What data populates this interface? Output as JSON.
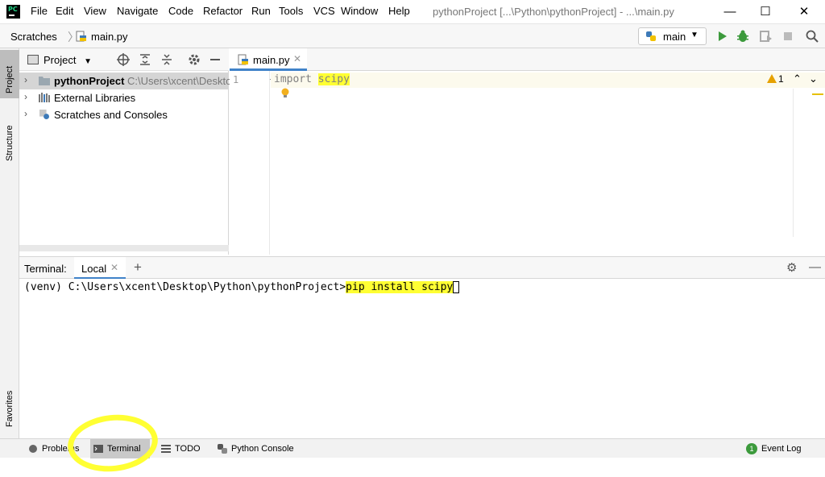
{
  "titlebar": {
    "menus": [
      "File",
      "Edit",
      "View",
      "Navigate",
      "Code",
      "Refactor",
      "Run",
      "Tools",
      "VCS",
      "Window",
      "Help"
    ],
    "title": "pythonProject [...\\Python\\pythonProject] - ...\\main.py",
    "minimize": "—",
    "maximize": "☐",
    "close": "✕"
  },
  "navbar": {
    "crumbs": [
      "Scratches",
      "main.py"
    ],
    "separator": "〉",
    "run_config": "main",
    "run_config_arrow": "▼",
    "tools": [
      "run-icon",
      "debug-icon",
      "coverage-icon",
      "stop-icon",
      "search-icon"
    ]
  },
  "left_strip": {
    "tabs": [
      "Project",
      "Structure",
      "Favorites"
    ]
  },
  "project": {
    "title": "Project",
    "title_arrow": "▼",
    "rows": [
      {
        "label": "pythonProject",
        "path": "C:\\Users\\xcent\\Desktop\\Python\\pythonProject"
      },
      {
        "label": "External Libraries"
      },
      {
        "label": "Scratches and Consoles"
      }
    ],
    "chevron": "›"
  },
  "editor": {
    "tab_label": "main.py",
    "tab_close": "✕",
    "line_number": "1",
    "code_keyword": "import",
    "code_module": "scipy",
    "warning_count": "1",
    "warn_up": "⌃",
    "warn_down": "⌄"
  },
  "terminal": {
    "title": "Terminal:",
    "tab_label": "Local",
    "tab_close": "✕",
    "add": "+",
    "prompt": "(venv) C:\\Users\\xcent\\Desktop\\Python\\pythonProject>",
    "command": "pip install scipy",
    "gear": "⚙",
    "minimize": "—"
  },
  "statusbar": {
    "items": [
      "Problems",
      "Terminal",
      "TODO",
      "Python Console"
    ],
    "event_log": "Event Log",
    "event_log_count": "1"
  },
  "colors": {
    "highlight": "#ffff33",
    "accent": "#4083c9",
    "run_green": "#3c9a3c"
  }
}
